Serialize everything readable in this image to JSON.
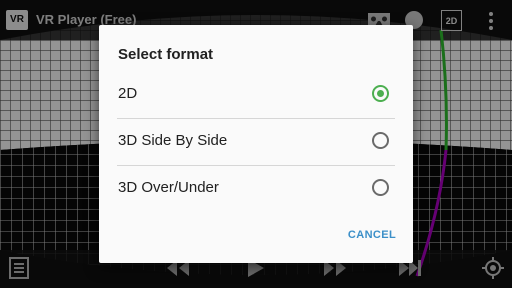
{
  "app": {
    "logo_text": "VR",
    "title": "VR Player (Free)"
  },
  "toolbar": {
    "mode_badge": "2D",
    "icons": [
      "cardboard-icon",
      "circle-icon",
      "more-vert-icon"
    ]
  },
  "dialog": {
    "title": "Select format",
    "options": [
      {
        "label": "2D",
        "selected": true
      },
      {
        "label": "3D Side By Side",
        "selected": false
      },
      {
        "label": "3D Over/Under",
        "selected": false
      }
    ],
    "cancel_label": "CANCEL"
  },
  "colors": {
    "accent_green": "#4caf50",
    "button_blue": "#3b8fc8",
    "track_green": "#2fbf2f",
    "track_purple": "#b000c8",
    "grid_gray": "#9a9a9a"
  },
  "bottom_icons": [
    "playlist-icon",
    "rewind-icon",
    "play-icon",
    "fast-forward-icon",
    "skip-icon",
    "locate-icon"
  ]
}
